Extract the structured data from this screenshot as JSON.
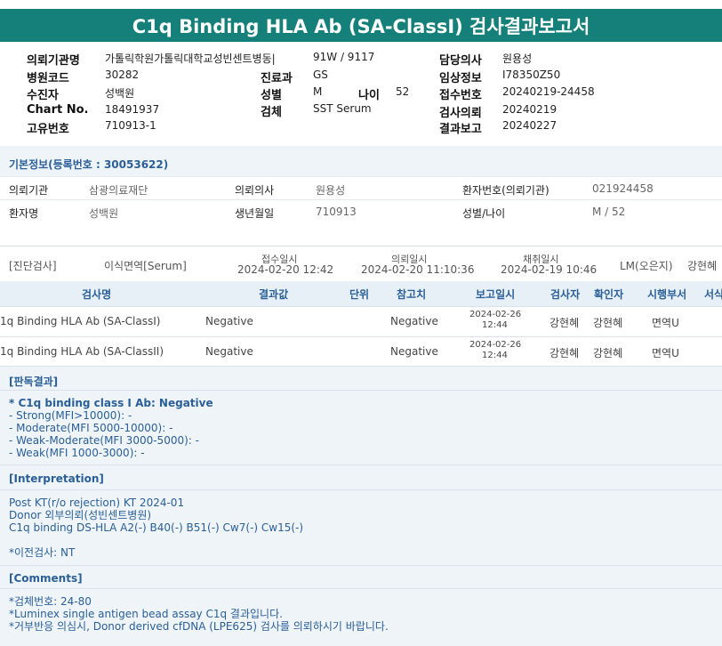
{
  "title": "C1q Binding HLA Ab (SA-ClassI) 검사결과보고서",
  "header": {
    "col1": [
      {
        "label": "의뢰기관명",
        "value": "가톨릭학원가톨릭대학교성빈센트병동|"
      },
      {
        "label": "병원코드",
        "value": "30282"
      },
      {
        "label": "수진자",
        "value": "성백원"
      },
      {
        "label": "Chart No.",
        "value": "18491937"
      },
      {
        "label": "고유번호",
        "value": "710913-1"
      }
    ],
    "col2_top_value": "91W / 9117",
    "col2": [
      {
        "label": "진료과",
        "value": "GS"
      },
      {
        "label": "성별",
        "value": "M"
      },
      {
        "label": "검체",
        "value": "SST Serum"
      }
    ],
    "age_label": "나이",
    "age_value": "52",
    "col3": [
      {
        "label": "담당의사",
        "value": "원용성"
      },
      {
        "label": "임상정보",
        "value": "I78350Z50"
      },
      {
        "label": "접수번호",
        "value": "20240219-24458"
      },
      {
        "label": "검사의뢰",
        "value": "20240219"
      },
      {
        "label": "결과보고",
        "value": "20240227"
      }
    ]
  },
  "basic": {
    "title": "기본정보(등록번호 : 30053622)",
    "rows": [
      {
        "a_label": "의뢰기관",
        "a_value": "삼광의료재단",
        "b_label": "의뢰의사",
        "b_value": "원용성",
        "c_label": "환자번호(의뢰기관)",
        "c_value": "021924458"
      },
      {
        "a_label": "환자명",
        "a_value": "성백원",
        "b_label": "생년월일",
        "b_value": "710913",
        "c_label": "성별/나이",
        "c_value": "M / 52"
      }
    ]
  },
  "exam": {
    "category": "[진단검사]",
    "specimen": "이식면역[Serum]",
    "received_label": "접수일시",
    "received_value": "2024-02-20 12:42",
    "requested_label": "의뢰일시",
    "requested_value": "2024-02-20 11:10:36",
    "collected_label": "채취일시",
    "collected_value": "2024-02-19 10:46",
    "lab": "LM(오은지)",
    "person": "강현혜"
  },
  "results": {
    "headers": [
      "검사명",
      "결과값",
      "단위",
      "참고치",
      "보고일시",
      "검사자",
      "확인자",
      "시행부서",
      "서식"
    ],
    "rows": [
      {
        "name": "1q Binding HLA Ab (SA-ClassI)",
        "result": "Negative",
        "unit": "",
        "ref": "Negative",
        "date1": "2024-02-26",
        "date2": "12:44",
        "tester": "강현혜",
        "checker": "강현혜",
        "dept": "면역U"
      },
      {
        "name": "1q Binding HLA Ab (SA-ClassII)",
        "result": "Negative",
        "unit": "",
        "ref": "Negative",
        "date1": "2024-02-26",
        "date2": "12:44",
        "tester": "강현혜",
        "checker": "강현혜",
        "dept": "면역U"
      }
    ]
  },
  "judgement": {
    "title": "[판독결과]",
    "lines": [
      "* C1q binding class I Ab: Negative",
      "- Strong(MFI>10000): -",
      "- Moderate(MFI 5000-10000): -",
      "- Weak-Moderate(MFI 3000-5000): -",
      "- Weak(MFI 1000-3000): -"
    ]
  },
  "interpretation": {
    "title": "[Interpretation]",
    "lines": [
      "Post KT(r/o rejection) KT 2024-01",
      "Donor 외부의뢰(성빈센트병원)",
      "C1q binding DS-HLA A2(-) B40(-) B51(-) Cw7(-) Cw15(-)"
    ],
    "prev": "*이전검사: NT"
  },
  "comments": {
    "title": "[Comments]",
    "lines": [
      "*검체번호: 24-80",
      "*Luminex single antigen bead assay C1q 결과입니다.",
      "*거부반응 의심시, Donor derived cfDNA (LPE625) 검사를 의뢰하시기 바랍니다."
    ]
  }
}
